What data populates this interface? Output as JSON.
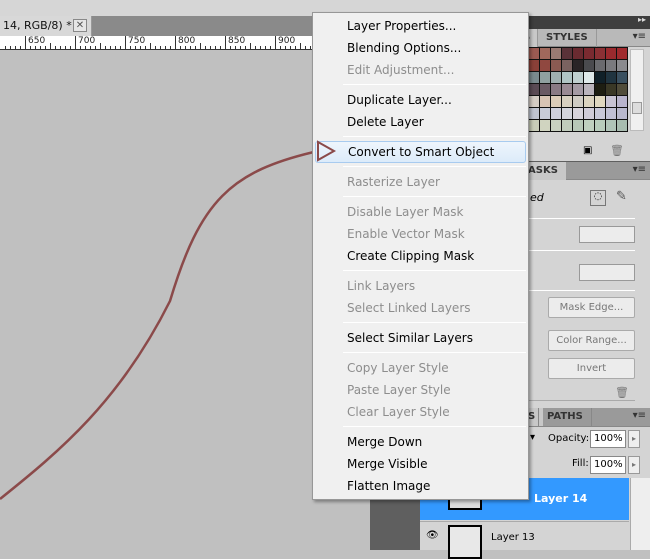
{
  "document": {
    "tab_title": "14, RGB/8) *",
    "close_label": "✕"
  },
  "ruler": {
    "labels": [
      "650",
      "700",
      "750",
      "800",
      "850",
      "900"
    ]
  },
  "context_menu": {
    "groups": [
      [
        {
          "label": "Layer Properties...",
          "enabled": true
        },
        {
          "label": "Blending Options...",
          "enabled": true
        },
        {
          "label": "Edit Adjustment...",
          "enabled": false
        }
      ],
      [
        {
          "label": "Duplicate Layer...",
          "enabled": true
        },
        {
          "label": "Delete Layer",
          "enabled": true
        }
      ],
      [
        {
          "label": "Convert to Smart Object",
          "enabled": true,
          "highlighted": true
        }
      ],
      [
        {
          "label": "Rasterize Layer",
          "enabled": false
        }
      ],
      [
        {
          "label": "Disable Layer Mask",
          "enabled": false
        },
        {
          "label": "Enable Vector Mask",
          "enabled": false
        },
        {
          "label": "Create Clipping Mask",
          "enabled": true
        }
      ],
      [
        {
          "label": "Link Layers",
          "enabled": false
        },
        {
          "label": "Select Linked Layers",
          "enabled": false
        }
      ],
      [
        {
          "label": "Select Similar Layers",
          "enabled": true
        }
      ],
      [
        {
          "label": "Copy Layer Style",
          "enabled": false
        },
        {
          "label": "Paste Layer Style",
          "enabled": false
        },
        {
          "label": "Clear Layer Style",
          "enabled": false
        }
      ],
      [
        {
          "label": "Merge Down",
          "enabled": true
        },
        {
          "label": "Merge Visible",
          "enabled": true
        },
        {
          "label": "Flatten Image",
          "enabled": true
        }
      ]
    ]
  },
  "swatches_panel": {
    "tab_partial": "S",
    "tab_styles": "STYLES",
    "colors": [
      [
        "#9b5a52",
        "#a0685c",
        "#9a7a72",
        "#5a3238",
        "#6a2a30",
        "#7a2a30",
        "#8a3034",
        "#9a2a2e",
        "#a02a2e"
      ],
      [
        "#8a4038",
        "#904840",
        "#8a5a52",
        "#7a6260",
        "#2a2426",
        "#4a4a4e",
        "#6a6a6e",
        "#7a7a7e",
        "#8a8a8e"
      ],
      [
        "#7a8a8e",
        "#90a0a0",
        "#a0b0b0",
        "#b0c4c4",
        "#c0d0d0",
        "#e0eaea",
        "#102028",
        "#203440",
        "#3a5060"
      ],
      [
        "#5a4a54",
        "#6a5a64",
        "#8a7a84",
        "#9a8a94",
        "#a49aa4",
        "#bab4bc",
        "#1e1e12",
        "#3a3826",
        "#504c3a"
      ],
      [
        "#d4ccc4",
        "#d8c4b4",
        "#dcccb8",
        "#d8d0c0",
        "#d0ccc4",
        "#dcd4c0",
        "#e0d8c0",
        "#c8c4d4",
        "#b8b4cc"
      ],
      [
        "#c0c4d0",
        "#c8ccd8",
        "#d0d0dc",
        "#d4d4dc",
        "#d8d4dc",
        "#d0ccd8",
        "#c8c8d8",
        "#c0c0d4",
        "#b8b8cc"
      ],
      [
        "#c8ccb8",
        "#d0d4c0",
        "#c8d0c0",
        "#c0ccbc",
        "#b8c8b8",
        "#c0d0c0",
        "#b8ccbc",
        "#b0c4b8",
        "#a8bcb0"
      ]
    ]
  },
  "masks_panel": {
    "tab_partial": "ASKS",
    "status_partial": "ed",
    "buttons": {
      "mask_edge": "Mask Edge...",
      "color_range": "Color Range...",
      "invert": "Invert"
    }
  },
  "layers_panel": {
    "tab_partial": "S",
    "tab_paths": "PATHS",
    "opacity_label": "Opacity:",
    "opacity_value": "100%",
    "fill_label": "Fill:",
    "fill_value": "100%",
    "layers": [
      {
        "name": "Layer 14",
        "name_partial": "4",
        "selected": true
      },
      {
        "name": "Layer 13",
        "selected": false,
        "visible": true
      }
    ]
  },
  "colors": {
    "arrow": "#8b4a4a",
    "selection": "#3399ff"
  }
}
